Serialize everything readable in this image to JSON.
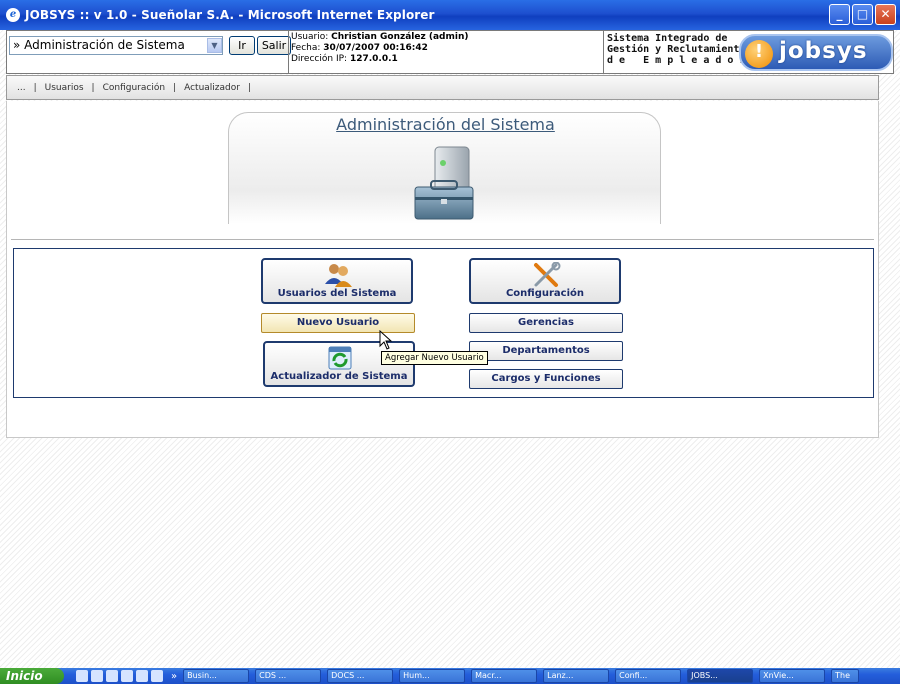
{
  "window": {
    "title": "JOBSYS :: v 1.0 - Sueñolar S.A. - Microsoft Internet Explorer",
    "minimize": "_",
    "maximize": "□",
    "close": "✕"
  },
  "header": {
    "select_value": "» Administración de Sistema",
    "ir_label": "Ir",
    "salir_label": "Salir",
    "user_label": "Usuario:",
    "user_value": "Christian González (admin)",
    "date_label": "Fecha:",
    "date_value": "30/07/2007 00:16:42",
    "ip_label": "Dirección IP:",
    "ip_value": "127.0.0.1",
    "system_line1": "Sistema Integrado de",
    "system_line2": "Gestión y Reclutamiento",
    "system_line3": "d e   E m p l e a d o s",
    "logo_text": "jobsys"
  },
  "menu": {
    "items": [
      "...",
      "|",
      "Usuarios",
      "|",
      "Configuración",
      "|",
      "Actualizador",
      "|"
    ]
  },
  "main": {
    "title": "Administración del Sistema",
    "buttons": {
      "usuarios": "Usuarios del Sistema",
      "configuracion": "Configuración",
      "nuevo_usuario": "Nuevo Usuario",
      "gerencias": "Gerencias",
      "departamentos": "Departamentos",
      "actualizador": "Actualizador de Sistema",
      "cargos": "Cargos y Funciones"
    },
    "tooltip": "Agregar Nuevo Usuario"
  },
  "taskbar": {
    "start": "Inicio",
    "chevron": "»",
    "tasks": [
      "Busin...",
      "CDS ...",
      "DOCS ...",
      "Hum...",
      "Macr...",
      "Lanz...",
      "Confi...",
      "JOBS...",
      "XnVie...",
      "The"
    ]
  },
  "colors": {
    "accent": "#1e3a6e",
    "title_bar": "#0f3fbf",
    "tooltip_bg": "#ffffe1"
  }
}
